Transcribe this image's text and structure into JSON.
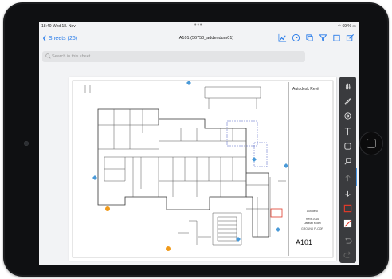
{
  "status_bar": {
    "time": "18:40  Wed 18. Nov",
    "battery": "69 %"
  },
  "toolbar": {
    "back_label": "Sheets (26)",
    "title": "A101 (56750_addendum01)",
    "icons": [
      "chart-icon",
      "clock-icon",
      "layers-icon",
      "filter-icon",
      "calendar-icon",
      "edit-icon"
    ]
  },
  "search": {
    "placeholder": "Search in this sheet"
  },
  "title_block": {
    "logo": "Autodesk Revit",
    "company": "Autodesk",
    "project_line1": "Revit 2016",
    "project_line2": "Dataset Model",
    "sheet_name": "GROUND FLOOR",
    "sheet_number": "A101"
  },
  "tools": [
    "hand-icon",
    "pen-icon",
    "shape-icon",
    "text-icon",
    "rectangle-icon",
    "callout-icon",
    "arrow-up-icon",
    "arrow-down-icon",
    "color-square-icon",
    "color-slash-icon",
    "undo-icon",
    "redo-icon"
  ],
  "colors": {
    "accent": "#2b7de9",
    "toolbar_bg": "#3a3b3e",
    "highlight": "#e03b2a"
  }
}
